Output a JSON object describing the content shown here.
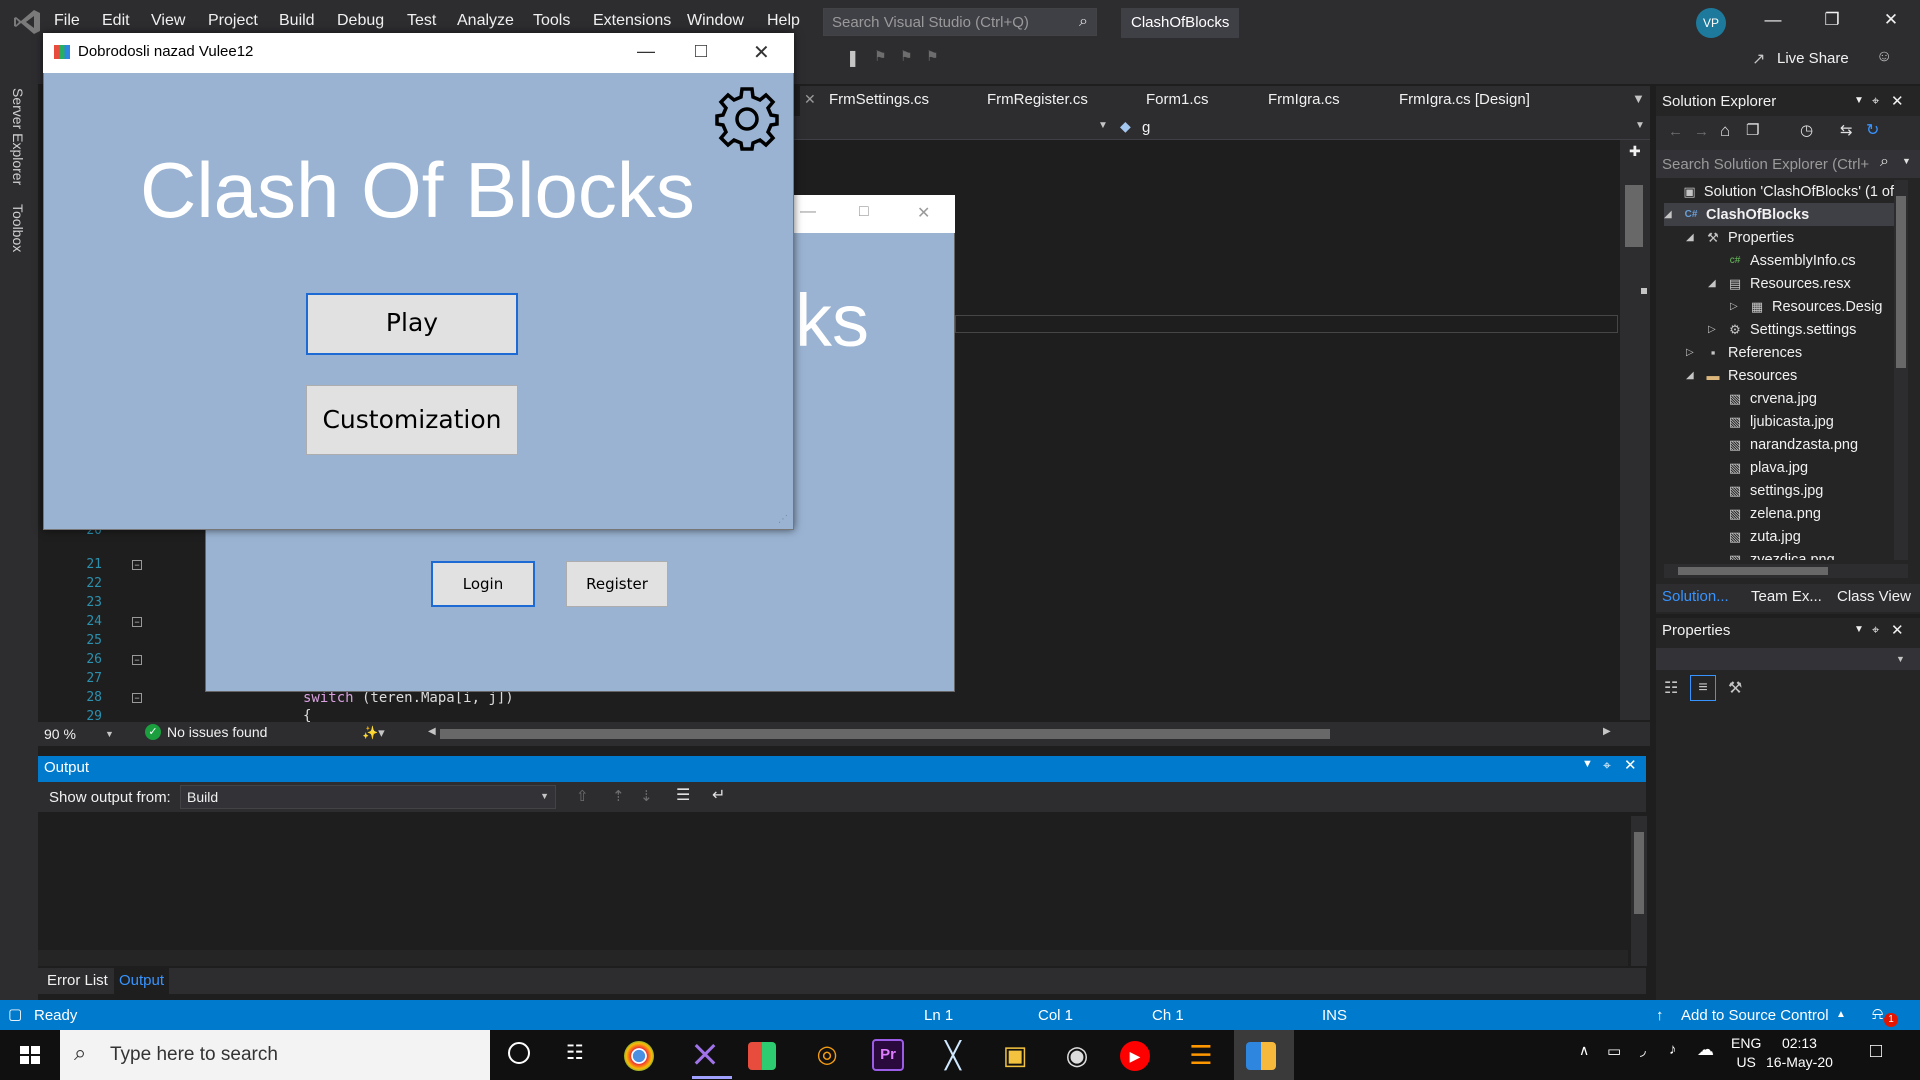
{
  "menu": [
    "File",
    "Edit",
    "View",
    "Project",
    "Build",
    "Debug",
    "Test",
    "Analyze",
    "Tools",
    "Extensions",
    "Window",
    "Help"
  ],
  "search": {
    "placeholder": "Search Visual Studio (Ctrl+Q)"
  },
  "solution_name": "ClashOfBlocks",
  "avatar": "VP",
  "live_share": "Live Share",
  "left_strip": [
    "Server Explorer",
    "Toolbox"
  ],
  "doc_tabs": [
    "FrmSettings.cs",
    "FrmRegister.cs",
    "Form1.cs",
    "FrmIgra.cs",
    "FrmIgra.cs [Design]"
  ],
  "nav_bar_value": "g",
  "line_numbers": [
    "20",
    "21",
    "22",
    "23",
    "24",
    "25",
    "26",
    "27",
    "28",
    "29"
  ],
  "code": {
    "keyword": "switch",
    "rest": " (teren.Mapa[i, j])",
    "next": "{"
  },
  "editor_status": {
    "zoom": "90 %",
    "issues": "No issues found"
  },
  "output": {
    "title": "Output",
    "show_from_label": "Show output from:",
    "show_from_value": "Build"
  },
  "bottom_tabs": [
    "Error List",
    "Output"
  ],
  "solution_explorer": {
    "title": "Solution Explorer",
    "search_placeholder": "Search Solution Explorer (Ctrl+",
    "tree": [
      {
        "label": "Solution 'ClashOfBlocks' (1 of",
        "icon": "solution-icon",
        "level": 0,
        "arrow": ""
      },
      {
        "label": "ClashOfBlocks",
        "icon": "csharp-project-icon",
        "level": 0,
        "arrow": "expanded"
      },
      {
        "label": "Properties",
        "icon": "wrench-icon",
        "level": 1,
        "arrow": "expanded"
      },
      {
        "label": "AssemblyInfo.cs",
        "icon": "csharp-file-icon",
        "level": 2,
        "arrow": ""
      },
      {
        "label": "Resources.resx",
        "icon": "resx-icon",
        "level": 2,
        "arrow": "expanded"
      },
      {
        "label": "Resources.Desig",
        "icon": "designer-icon",
        "level": 3,
        "arrow": "collapsed"
      },
      {
        "label": "Settings.settings",
        "icon": "settings-gear-icon",
        "level": 2,
        "arrow": "collapsed"
      },
      {
        "label": "References",
        "icon": "references-icon",
        "level": 1,
        "arrow": "collapsed"
      },
      {
        "label": "Resources",
        "icon": "folder-icon",
        "level": 1,
        "arrow": "expanded"
      },
      {
        "label": "crvena.jpg",
        "icon": "image-file-icon",
        "level": 2,
        "arrow": ""
      },
      {
        "label": "ljubicasta.jpg",
        "icon": "image-file-icon",
        "level": 2,
        "arrow": ""
      },
      {
        "label": "narandzasta.png",
        "icon": "image-file-icon",
        "level": 2,
        "arrow": ""
      },
      {
        "label": "plava.jpg",
        "icon": "image-file-icon",
        "level": 2,
        "arrow": ""
      },
      {
        "label": "settings.jpg",
        "icon": "image-file-icon",
        "level": 2,
        "arrow": ""
      },
      {
        "label": "zelena.png",
        "icon": "image-file-icon",
        "level": 2,
        "arrow": ""
      },
      {
        "label": "zuta.jpg",
        "icon": "image-file-icon",
        "level": 2,
        "arrow": ""
      },
      {
        "label": "zvezdica.png",
        "icon": "image-file-icon",
        "level": 2,
        "arrow": ""
      }
    ],
    "bottom_tabs": [
      "Solution...",
      "Team Ex...",
      "Class View"
    ]
  },
  "properties": {
    "title": "Properties"
  },
  "statusbar": {
    "ready": "Ready",
    "ln": "Ln 1",
    "col": "Col 1",
    "ch": "Ch 1",
    "mode": "INS",
    "source_control": "Add to Source Control",
    "notifications": "1"
  },
  "taskbar": {
    "search_placeholder": "Type here to search",
    "lang": "ENG",
    "region": "US",
    "time": "02:13",
    "date": "16-May-20"
  },
  "login_form": {
    "title_fragment": "ks",
    "login": "Login",
    "register": "Register"
  },
  "main_form": {
    "window_title": "Dobrodosli nazad Vulee12",
    "game_title": "Clash Of Blocks",
    "play": "Play",
    "customization": "Customization"
  },
  "colors": {
    "vs_chrome": "#2d2d30",
    "accent_blue": "#007acc",
    "form_background": "#9ab3d2",
    "button_focus_border": "#1e6ad4"
  }
}
